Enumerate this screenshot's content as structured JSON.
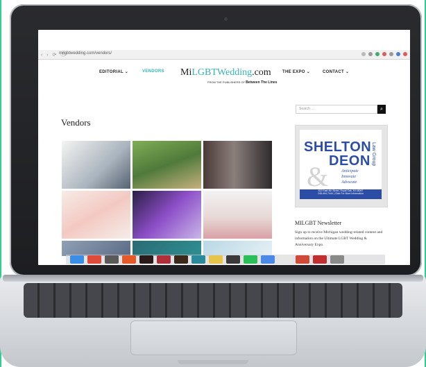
{
  "browser": {
    "url": "milgbtwedding.com/vendors/"
  },
  "site": {
    "logo_prefix": "Mi",
    "logo_accent": "LGBTWedding",
    "logo_suffix": ".com",
    "logo_sub": "FROM THE PUBLISHERS OF",
    "logo_sub_brand": "Between The Lines",
    "nav": [
      "EDITORIAL ⌄",
      "VENDORS",
      "THE EXPO ⌄",
      "CONTACT ⌄"
    ],
    "accent_color": "#35b3b6"
  },
  "main": {
    "title": "Vendors"
  },
  "sidebar": {
    "search_placeholder": "Search …",
    "ad": {
      "line1": "SHELTON",
      "line2": "DEON",
      "amp": "&",
      "law": "Law Group",
      "tag1": "Anticipate",
      "tag2": "Innovate",
      "tag3": "Advocate",
      "address": "622 East 4th Street, Royal Oak, MI 48067",
      "phone": "248-494-7444 | Click For More Information"
    },
    "newsletter_title": "MILGBT Newsletter",
    "newsletter_text": "Sign up to receive Michigan wedding-related content and information on the Ultimate LGBT Wedding & Anniversary Expo."
  },
  "icons": {
    "search": "search-icon",
    "camera": "camera-icon"
  }
}
